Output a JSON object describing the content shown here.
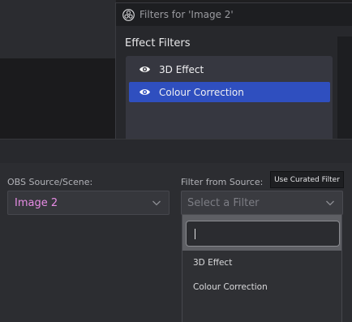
{
  "filters_window": {
    "title": "Filters for 'Image 2'",
    "heading": "Effect Filters",
    "items": [
      {
        "label": "3D Effect",
        "icon": "eye-icon",
        "selected": false
      },
      {
        "label": "Colour Correction",
        "icon": "eye-icon",
        "selected": true
      }
    ]
  },
  "dialog": {
    "source_label": "OBS Source/Scene:",
    "source_value": "Image 2",
    "filter_label": "Filter from Source:",
    "filter_placeholder": "Select a Filter",
    "tooltip": "Use Curated Filter",
    "dropdown_search_value": "",
    "dropdown_options": [
      "3D Effect",
      "Colour Correction"
    ]
  },
  "colors": {
    "accent_selected": "#2f4fbf",
    "source_value": "#e78ce5"
  }
}
